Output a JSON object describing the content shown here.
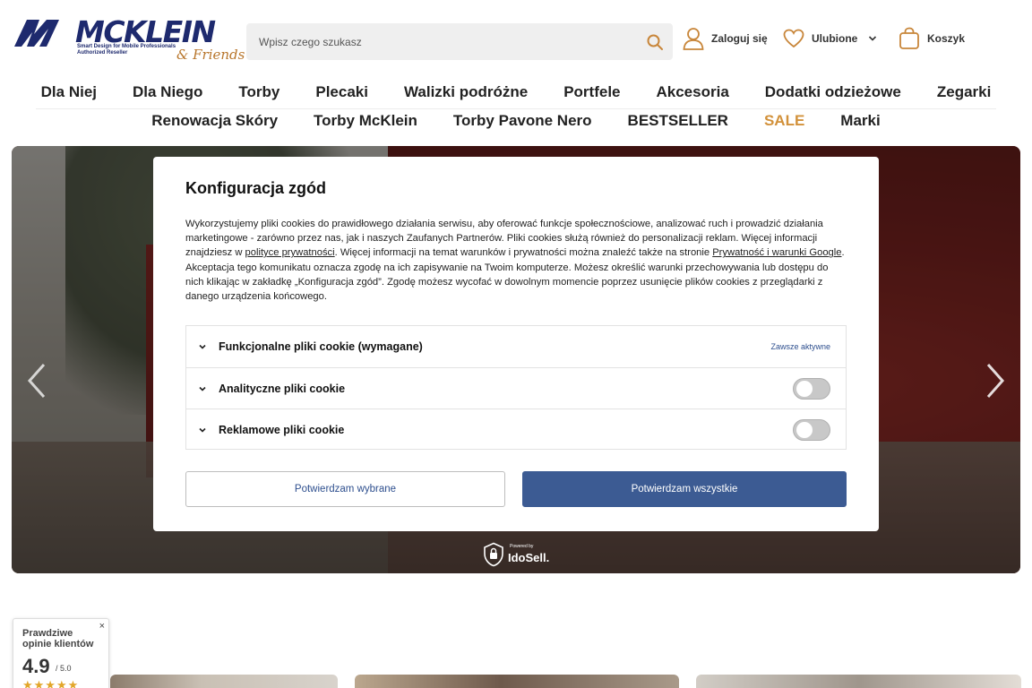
{
  "header": {
    "logo_text": "MCKLEIN",
    "logo_tagline": "Smart Design for Mobile Professionals",
    "logo_tagline2": "Authorized Reseller",
    "logo_friends": "& Friends",
    "search_placeholder": "Wpisz czego szukasz",
    "login_label": "Zaloguj się",
    "favorites_label": "Ulubione",
    "cart_label": "Koszyk"
  },
  "nav": {
    "row1": [
      "Dla Niej",
      "Dla Niego",
      "Torby",
      "Plecaki",
      "Walizki podróżne",
      "Portfele",
      "Akcesoria",
      "Dodatki odzieżowe",
      "Zegarki"
    ],
    "row2": [
      "Renowacja Skóry",
      "Torby McKlein",
      "Torby Pavone Nero",
      "BESTSELLER",
      "SALE",
      "Marki"
    ]
  },
  "powered": {
    "small": "Powered by",
    "big": "IdoSell."
  },
  "consent": {
    "title": "Konfiguracja zgód",
    "text_part1": "Wykorzystujemy pliki cookies do prawidłowego działania serwisu, aby oferować funkcje społecznościowe, analizować ruch i prowadzić działania marketingowe - zarówno przez nas, jak i naszych Zaufanych Partnerów. Pliki cookies służą również do personalizacji reklam. Więcej informacji znajdziesz w ",
    "link_privacy": "polityce prywatności",
    "text_part2": ". Więcej informacji na temat warunków i prywatności można znaleźć także na stronie ",
    "link_google": "Prywatność i warunki Google",
    "text_part3": ". Akceptacja tego komunikatu oznacza zgodę na ich zapisywanie na Twoim komputerze. Możesz określić warunki przechowywania lub dostępu do nich klikając w zakładkę „Konfiguracja zgód”. Zgodę możesz wycofać w dowolnym momencie poprzez usunięcie plików cookies z przeglądarki z danego urządzenia końcowego.",
    "rows": [
      {
        "label": "Funkcjonalne pliki cookie (wymagane)",
        "status": "Zawsze aktywne"
      },
      {
        "label": "Analityczne pliki cookie"
      },
      {
        "label": "Reklamowe pliki cookie"
      }
    ],
    "btn_selected": "Potwierdzam wybrane",
    "btn_all": "Potwierdzam wszystkie"
  },
  "reviews": {
    "title": "Prawdziwe opinie klientów",
    "close": "×",
    "score": "4.9",
    "max": "/ 5.0",
    "stars": "★★★★★"
  },
  "colors": {
    "brand_navy": "#1e2a6e",
    "accent_gold": "#d2913a",
    "button_blue": "#3c5b93",
    "icon_tan": "#c8863a"
  }
}
